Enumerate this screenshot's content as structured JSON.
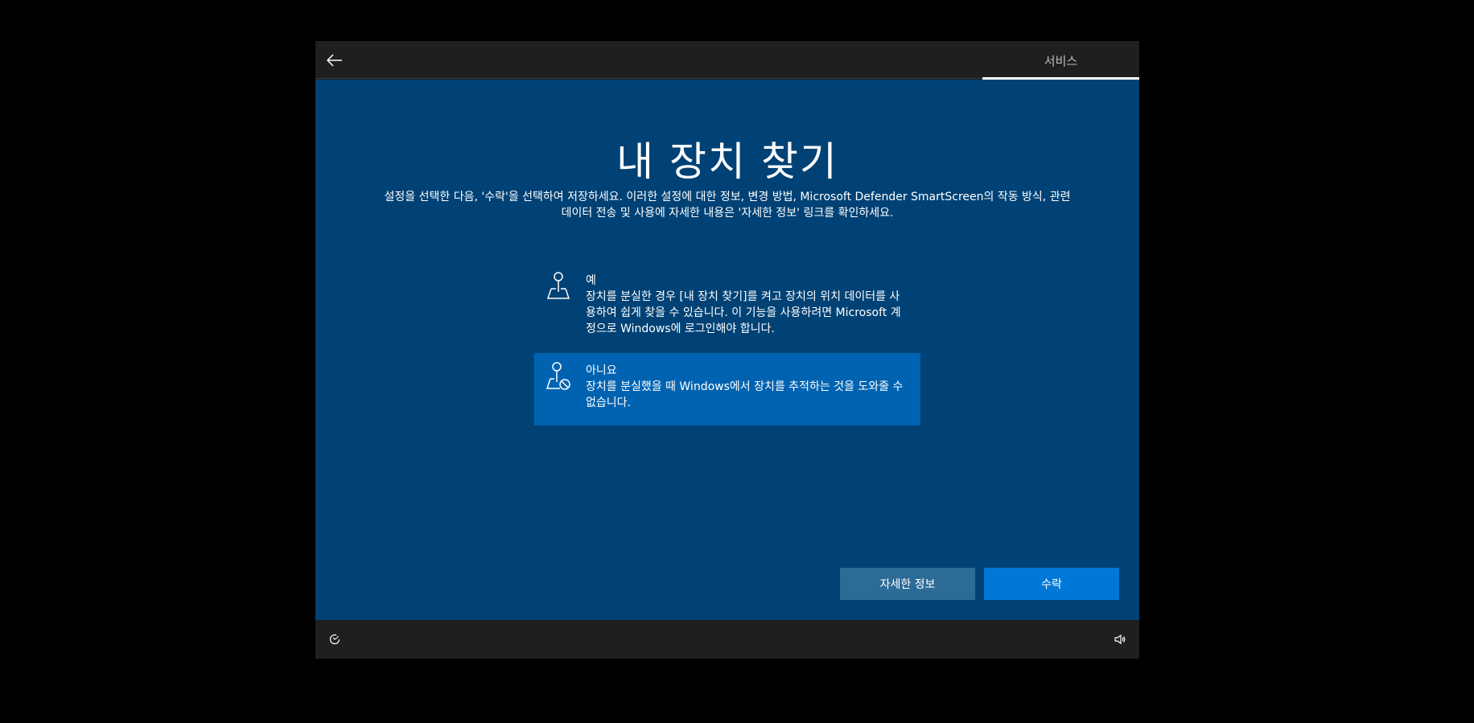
{
  "header": {
    "back_icon": "back-arrow-icon",
    "progress_tab": "서비스"
  },
  "main": {
    "title": "내 장치 찾기",
    "subtitle_line1": "설정을 선택한 다음, '수락'을 선택하여 저장하세요. 이러한 설정에 대한 정보, 변경 방법, Microsoft Defender SmartScreen의 작동 방식, 관련",
    "subtitle_line2": "데이터 전송 및 사용에 자세한 내용은 '자세한 정보' 링크를 확인하세요.",
    "options": [
      {
        "icon": "map-pin-icon",
        "title": "예",
        "description": "장치를 분실한 경우 [내 장치 찾기]를 켜고 장치의 위치 데이터를 사용하여 쉽게 찾을 수 있습니다. 이 기능을 사용하려면 Microsoft 계정으로 Windows에 로그인해야 합니다.",
        "selected": false
      },
      {
        "icon": "map-pin-blocked-icon",
        "title": "아니요",
        "description": "장치를 분실했을 때 Windows에서 장치를 추적하는 것을 도와줄 수 없습니다.",
        "selected": true
      }
    ]
  },
  "buttons": {
    "learn_more": "자세한 정보",
    "accept": "수락"
  },
  "footer": {
    "accessibility_icon": "ease-of-access-icon",
    "volume_icon": "volume-icon"
  },
  "colors": {
    "background": "#004275",
    "selected_option": "#0063b1",
    "accept_button": "#0078d7",
    "learn_more_button": "#2d6b97",
    "bar": "#1f1f1f"
  }
}
